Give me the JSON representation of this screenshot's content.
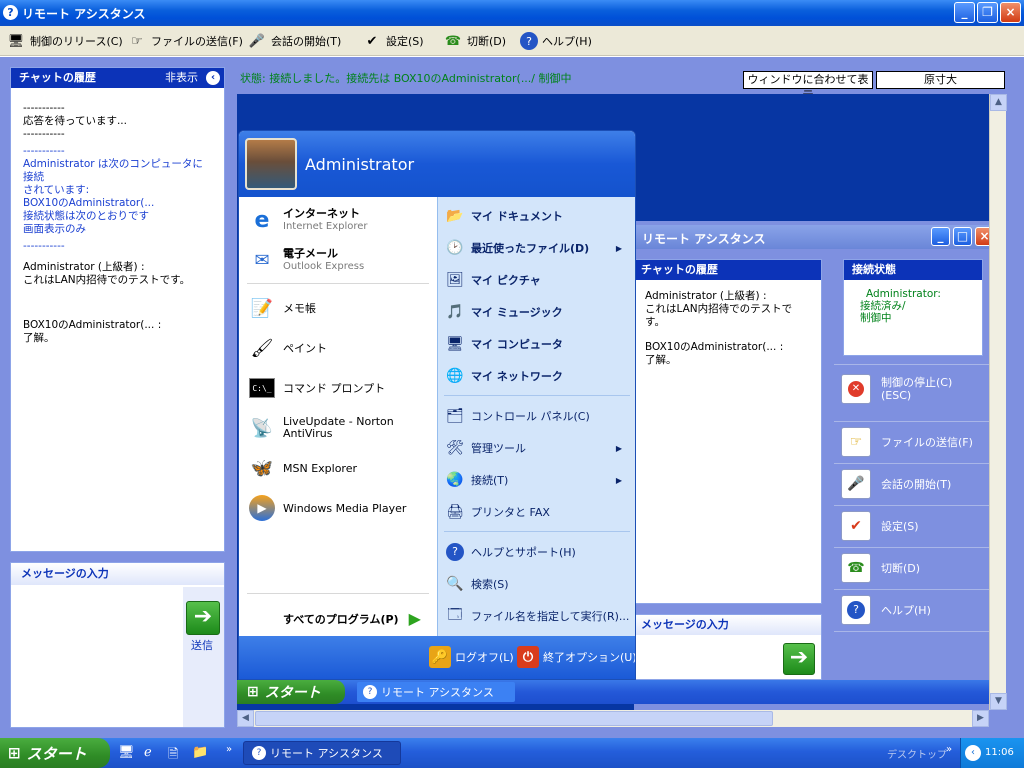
{
  "window": {
    "title": "リモート アシスタンス"
  },
  "toolbar": {
    "items": [
      {
        "label": "制御のリリース(C)",
        "icon": "release-control-icon"
      },
      {
        "label": "ファイルの送信(F)",
        "icon": "send-file-icon"
      },
      {
        "label": "会話の開始(T)",
        "icon": "microphone-icon"
      },
      {
        "label": "設定(S)",
        "icon": "settings-icon"
      },
      {
        "label": "切断(D)",
        "icon": "disconnect-icon"
      },
      {
        "label": "ヘルプ(H)",
        "icon": "help-icon"
      }
    ]
  },
  "chat": {
    "title": "チャットの履歴",
    "hide_label": "非表示",
    "lines": [
      {
        "text": "-----------",
        "color": "black"
      },
      {
        "text": "応答を待っています...",
        "color": "black"
      },
      {
        "text": "-----------",
        "color": "black"
      },
      {
        "text": "-----------",
        "color": "blue"
      },
      {
        "text": "Administrator は次のコンピュータに接続",
        "color": "blue"
      },
      {
        "text": "されています:",
        "color": "blue"
      },
      {
        "text": "BOX10のAdministrator(...",
        "color": "blue"
      },
      {
        "text": "接続状態は次のとおりです",
        "color": "blue"
      },
      {
        "text": "画面表示のみ",
        "color": "blue"
      },
      {
        "text": "-----------",
        "color": "blue"
      },
      {
        "text": "Administrator (上級者) :",
        "color": "black"
      },
      {
        "text": " これはLAN内招待でのテストです。",
        "color": "black"
      },
      {
        "text": "BOX10のAdministrator(... :",
        "color": "black"
      },
      {
        "text": " 了解。",
        "color": "black"
      }
    ]
  },
  "message": {
    "title": "メッセージの入力",
    "send_label": "送信"
  },
  "status": {
    "text": "状態: 接続しました。接続先は BOX10のAdministrator(.../ 制御中",
    "fit_label": "ウィンドウに合わせて表示",
    "actual_label": "原寸大"
  },
  "startmenu": {
    "user": "Administrator",
    "left_items": [
      {
        "title": "インターネット",
        "subtitle": "Internet Explorer",
        "icon": "internet-explorer-icon"
      },
      {
        "title": "電子メール",
        "subtitle": "Outlook Express",
        "icon": "outlook-express-icon"
      },
      {
        "title": "メモ帳",
        "icon": "notepad-icon"
      },
      {
        "title": "ペイント",
        "icon": "paint-icon"
      },
      {
        "title": "コマンド プロンプト",
        "icon": "command-prompt-icon"
      },
      {
        "title": "LiveUpdate - Norton",
        "subtitle2": "AntiVirus",
        "icon": "liveupdate-icon"
      },
      {
        "title": "MSN Explorer",
        "icon": "msn-icon"
      },
      {
        "title": "Windows Media Player",
        "icon": "media-player-icon"
      }
    ],
    "all_programs": "すべてのプログラム(P)",
    "right_items": [
      {
        "label": "マイ ドキュメント",
        "bold": true,
        "icon": "my-documents-icon"
      },
      {
        "label": "最近使ったファイル(D)",
        "bold": true,
        "arrow": true,
        "icon": "recent-files-icon"
      },
      {
        "label": "マイ ピクチャ",
        "bold": true,
        "icon": "my-pictures-icon"
      },
      {
        "label": "マイ ミュージック",
        "bold": true,
        "icon": "my-music-icon"
      },
      {
        "label": "マイ コンピュータ",
        "bold": true,
        "icon": "my-computer-icon"
      },
      {
        "label": "マイ ネットワーク",
        "bold": true,
        "icon": "my-network-icon"
      },
      {
        "label": "コントロール パネル(C)",
        "icon": "control-panel-icon"
      },
      {
        "label": "管理ツール",
        "arrow": true,
        "icon": "admin-tools-icon"
      },
      {
        "label": "接続(T)",
        "arrow": true,
        "icon": "connect-icon"
      },
      {
        "label": "プリンタと FAX",
        "icon": "printer-icon"
      },
      {
        "label": "ヘルプとサポート(H)",
        "icon": "help-support-icon"
      },
      {
        "label": "検索(S)",
        "icon": "search-icon"
      },
      {
        "label": "ファイル名を指定して実行(R)...",
        "icon": "run-icon"
      }
    ],
    "logoff": "ログオフ(L)",
    "shutdown": "終了オプション(U)"
  },
  "remote_taskbar": {
    "start": "スタート",
    "task": "リモート アシスタンス"
  },
  "inner": {
    "title": "リモート アシスタンス",
    "chat_title": "チャットの履歴",
    "chat_lines": [
      "Administrator (上級者) :",
      "これはLAN内招待でのテストです。",
      "",
      "BOX10のAdministrator(... :",
      " 了解。"
    ],
    "status_title": "接続状態",
    "status_lines": [
      "Administrator:",
      "接続済み/",
      "制御中"
    ],
    "message_title": "メッセージの入力",
    "buttons": [
      {
        "label": "制御の停止(C)",
        "label2": "(ESC)",
        "icon": "stop-control-icon"
      },
      {
        "label": "ファイルの送信(F)",
        "icon": "send-file-icon"
      },
      {
        "label": "会話の開始(T)",
        "icon": "microphone-icon"
      },
      {
        "label": "設定(S)",
        "icon": "settings-icon"
      },
      {
        "label": "切断(D)",
        "icon": "disconnect-icon"
      },
      {
        "label": "ヘルプ(H)",
        "icon": "help-icon"
      }
    ]
  },
  "taskbar": {
    "start": "スタート",
    "task": "リモート アシスタンス",
    "desktop": "デスクトップ",
    "time": "11:06"
  }
}
